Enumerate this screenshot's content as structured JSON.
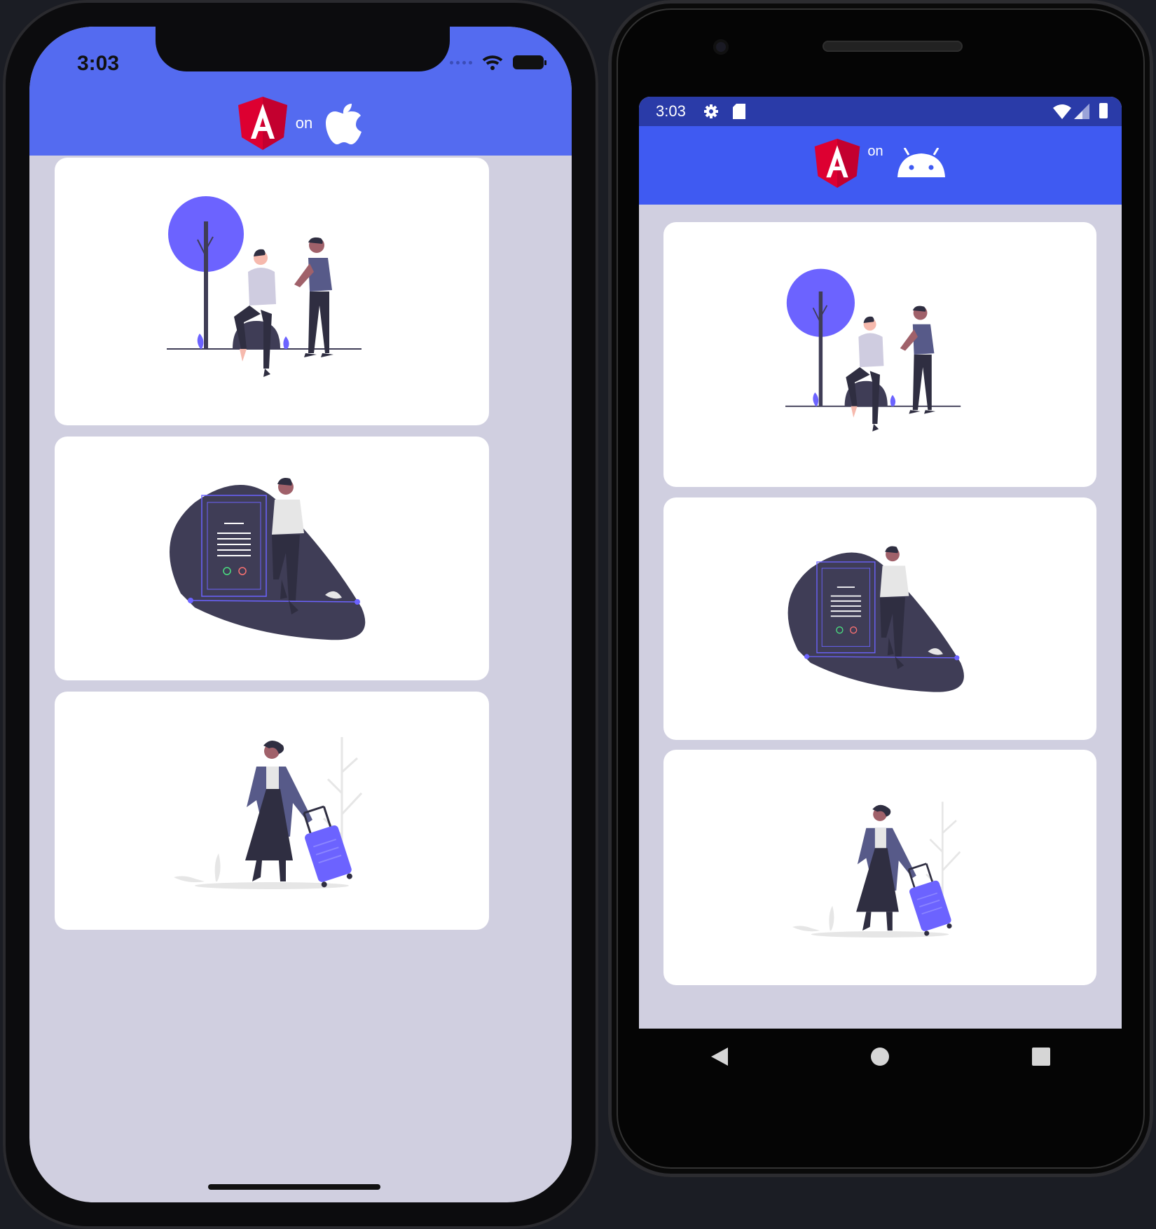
{
  "ios": {
    "time": "3:03",
    "brand_on": "on",
    "cards": [
      {
        "illustration": "people-talking-under-tree"
      },
      {
        "illustration": "man-leaning-on-phone-screen"
      },
      {
        "illustration": "woman-with-suitcase"
      }
    ]
  },
  "android": {
    "time": "3:03",
    "brand_on": "on",
    "cards": [
      {
        "illustration": "people-talking-under-tree"
      },
      {
        "illustration": "man-leaning-on-phone-screen"
      },
      {
        "illustration": "woman-with-suitcase"
      }
    ]
  },
  "colors": {
    "ios_header": "#546bf0",
    "android_header": "#3f5af2",
    "android_statusbar": "#2a3ba8",
    "background": "#d0cfe0",
    "card": "#ffffff",
    "accent_purple": "#6c63ff",
    "angular_red": "#dd0031",
    "dark_figure": "#3f3d56"
  }
}
